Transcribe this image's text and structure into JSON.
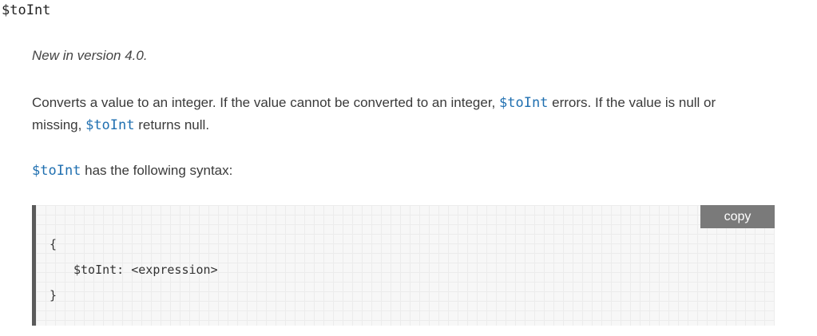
{
  "heading": "$toInt",
  "version_note": "New in version 4.0.",
  "description": {
    "part1": "Converts a value to an integer. If the value cannot be converted to an integer, ",
    "code1": "$toInt",
    "part2": " errors. If the value is null or missing, ",
    "code2": "$toInt",
    "part3": " returns null."
  },
  "syntax": {
    "code": "$toInt",
    "text": " has the following syntax:"
  },
  "code_block": {
    "copy_label": "copy",
    "lines": [
      "{",
      "$toInt: <expression>",
      "}"
    ]
  },
  "colors": {
    "code_text": "#1f6fb0",
    "copy_bg": "#7a7a7a",
    "block_border": "#5a5a5a"
  }
}
